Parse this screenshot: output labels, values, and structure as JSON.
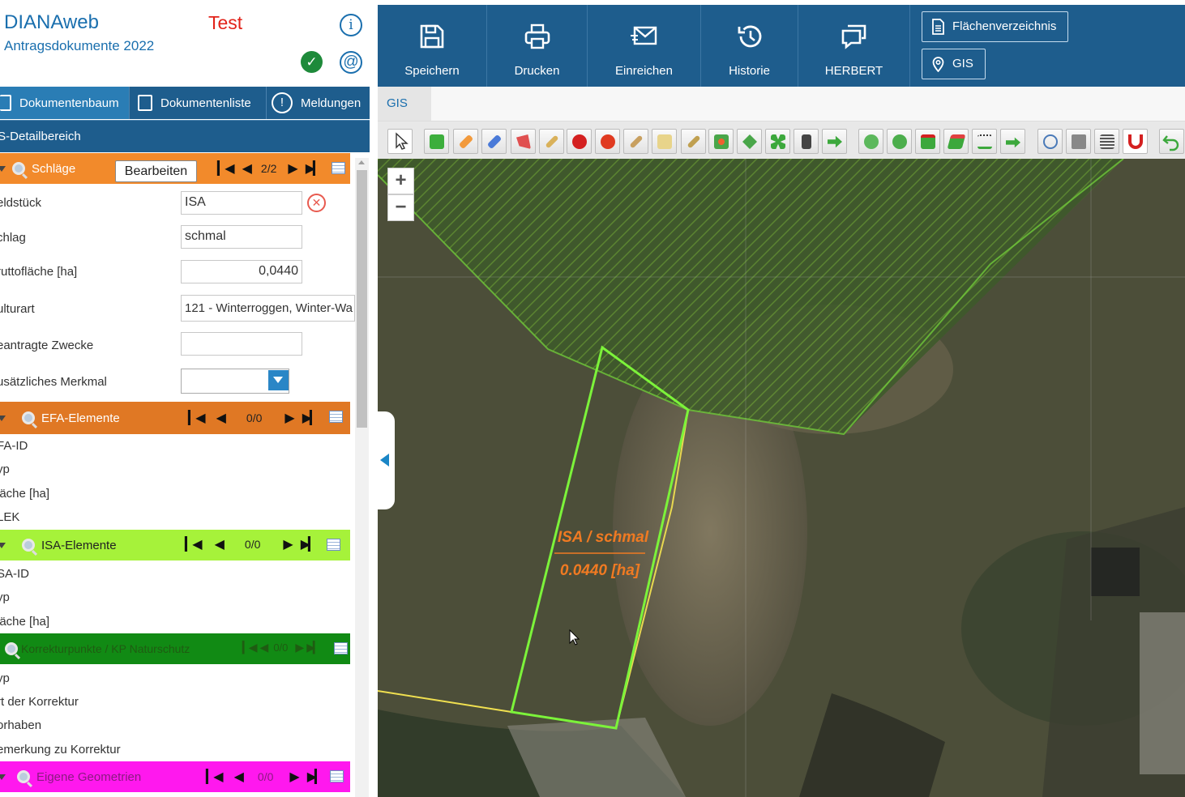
{
  "app": {
    "title": "DIANAweb",
    "subtitle": "Antragsdokumente 2022",
    "environment": "Test"
  },
  "left_tabs": [
    {
      "label": "Dokumentenbaum"
    },
    {
      "label": "Dokumentenliste"
    },
    {
      "label": "Meldungen"
    }
  ],
  "detail_header": "IS-Detailbereich",
  "groups": {
    "schlaege": {
      "label": "Schläge",
      "count": "2/2",
      "edit_label": "Bearbeiten",
      "color": "#f28a2b"
    },
    "efa": {
      "label": "EFA-Elemente",
      "count": "0/0",
      "color": "#e07824"
    },
    "isa": {
      "label": "ISA-Elemente",
      "count": "0/0",
      "color": "#a6f23a"
    },
    "korrektur": {
      "label": "Korrekturpunkte / KP Naturschutz",
      "count": "0/0",
      "color": "#118a14"
    },
    "eigene": {
      "label": "Eigene Geometrien",
      "count": "0/0",
      "color": "#ff18ee"
    }
  },
  "fields": {
    "feldstueck": {
      "label": "eldstück",
      "value": "ISA"
    },
    "schlag": {
      "label": "chlag",
      "value": "schmal"
    },
    "brutto": {
      "label": "ruttofläche [ha]",
      "value": "0,0440"
    },
    "kulturart": {
      "label": "ulturart",
      "value": "121 - Winterroggen, Winter-Wa"
    },
    "zwecke": {
      "label": "eantragte Zwecke",
      "value": ""
    },
    "merkmal": {
      "label": "usätzliches Merkmal",
      "value": ""
    }
  },
  "efa_fields": [
    "FA-ID",
    "yp",
    "läche [ha]",
    "LEK"
  ],
  "isa_fields": [
    "SA-ID",
    "yp",
    "läche [ha]"
  ],
  "korrektur_fields": [
    "yp",
    "rt der Korrektur",
    "orhaben",
    "emerkung zu Korrektur"
  ],
  "topbar": {
    "buttons": [
      {
        "label": "Speichern",
        "icon": "save-icon"
      },
      {
        "label": "Drucken",
        "icon": "print-icon"
      },
      {
        "label": "Einreichen",
        "icon": "send-mail-icon"
      },
      {
        "label": "Historie",
        "icon": "history-icon"
      },
      {
        "label": "HERBERT",
        "icon": "chat-icon"
      }
    ],
    "flaechenverzeichnis": "Flächenverzeichnis",
    "gis": "GIS"
  },
  "gis_tab": "GIS",
  "map": {
    "label_name": "ISA / schmal",
    "label_area": "0.0440 [ha]"
  },
  "colors": {
    "primary": "#1e5d8d",
    "accent_blue": "#1a6fae",
    "env_red": "#e2231a",
    "map_outline": "#7cf33a",
    "map_label": "#f07a22"
  }
}
